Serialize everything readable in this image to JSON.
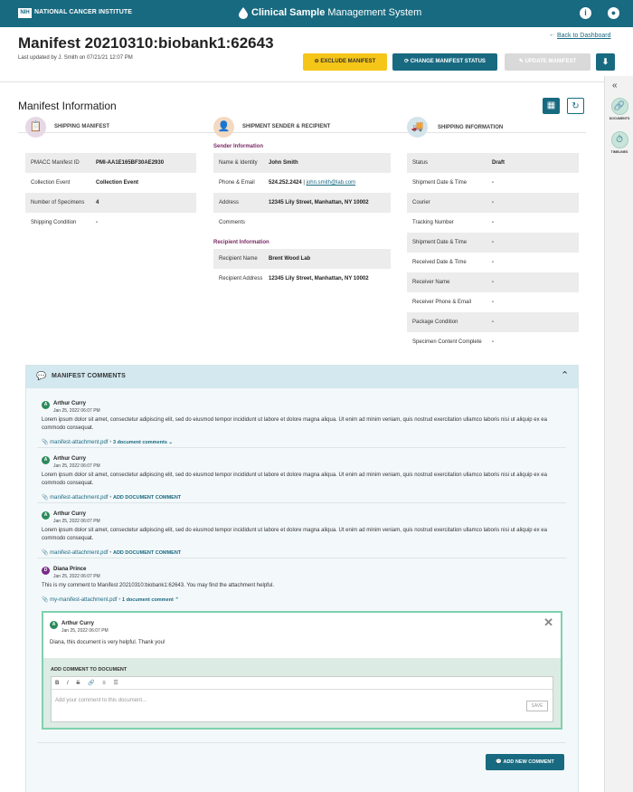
{
  "topbar": {
    "logo_badge": "NIH",
    "org": "NATIONAL CANCER INSTITUTE",
    "app_title_bold": "Clinical Sample",
    "app_title_rest": " Management System",
    "info_icon": "info-icon",
    "user_icon": "user-icon",
    "color": "#186a80"
  },
  "header": {
    "title": "Manifest 20210310:biobank1:62643",
    "updated": "Last updated by J. Smith on 07/21/21 12:07 PM",
    "back_link": "Back to Dashboard",
    "buttons": {
      "exclude": "EXCLUDE MANIFEST",
      "change": "CHANGE MANIFEST STATUS",
      "update": "UPDATE MANIFEST"
    }
  },
  "colors": {
    "primary": "#186a80",
    "exclude": "#f5c518",
    "accent": "#7a2a66",
    "highlight": "#7fd1ad"
  },
  "side_panel": {
    "items": [
      {
        "label": "DOCUMENTS",
        "icon": "paperclip-icon"
      },
      {
        "label": "TIMELINES",
        "icon": "stopwatch-icon"
      }
    ]
  },
  "manifest_info": {
    "title": "Manifest Information",
    "shipping_manifest": {
      "title": "SHIPPING MANIFEST",
      "rows": [
        {
          "k": "PMACC Manifest ID",
          "v": "PMI-AA1E165BF30AE2930"
        },
        {
          "k": "Collection Event",
          "v": "Collection Event"
        },
        {
          "k": "Number of Specimens",
          "v": "4"
        },
        {
          "k": "Shipping Condition",
          "v": "-"
        }
      ]
    },
    "sender_recipient": {
      "title": "SHIPMENT SENDER & RECIPIENT",
      "sender_title": "Sender Information",
      "sender_rows": [
        {
          "k": "Name & Identity",
          "v": "John Smith"
        },
        {
          "k": "Phone & Email",
          "phone": "524.252.2424",
          "sep": " | ",
          "email": "john.smith@lab.com"
        },
        {
          "k": "Address",
          "v": "12345 Lily Street, Manhattan, NY 10002"
        },
        {
          "k": "Comments",
          "v": ""
        }
      ],
      "recipient_title": "Recipient Information",
      "recipient_rows": [
        {
          "k": "Recipient Name",
          "v": "Brent Wood Lab"
        },
        {
          "k": "Recipient Address",
          "v": "12345 Lily Street, Manhattan, NY 10002"
        }
      ]
    },
    "shipping_info": {
      "title": "SHIPPING INFORMATION",
      "rows": [
        {
          "k": "Status",
          "v": "Draft"
        },
        {
          "k": "Shipment Date & Time",
          "v": "-"
        },
        {
          "k": "Courier",
          "v": "-"
        },
        {
          "k": "Tracking Number",
          "v": "-"
        },
        {
          "k": "Shipment Date & Time",
          "v": "-"
        },
        {
          "k": "Received Date & Time",
          "v": "-"
        },
        {
          "k": "Receiver Name",
          "v": "-"
        },
        {
          "k": "Receiver Phone & Email",
          "v": "-"
        },
        {
          "k": "Package Condition",
          "v": "-"
        },
        {
          "k": "Specimen Content Complete",
          "v": "-"
        }
      ]
    }
  },
  "comments": {
    "title": "MANIFEST COMMENTS",
    "items": [
      {
        "initial": "A",
        "name": "Arthur Curry",
        "date": "Jan 25, 2022 06:07 PM",
        "text": "Lorem ipsum dolor sit amet, consectetur adipiscing elit, sed do eiusmod tempor incididunt ut labore et dolore magna aliqua. Ut enim ad minim veniam, quis nostrud exercitation ullamco laboris nisi ut aliquip ex ea commodo consequat.",
        "file": "manifest-attachment.pdf",
        "action": "3 document comments ⌄"
      },
      {
        "initial": "A",
        "name": "Arthur Curry",
        "date": "Jan 25, 2022 06:07 PM",
        "text": "Lorem ipsum dolor sit amet, consectetur adipiscing elit, sed do eiusmod tempor incididunt ut labore et dolore magna aliqua. Ut enim ad minim veniam, quis nostrud exercitation ullamco laboris nisi ut aliquip ex ea commodo consequat.",
        "file": "manifest-attachment.pdf",
        "action": "ADD DOCUMENT COMMENT"
      },
      {
        "initial": "A",
        "name": "Arthur Curry",
        "date": "Jan 25, 2022 06:07 PM",
        "text": "Lorem ipsum dolor sit amet, consectetur adipiscing elit, sed do eiusmod tempor incididunt ut labore et dolore magna aliqua. Ut enim ad minim veniam, quis nostrud exercitation ullamco laboris nisi ut aliquip ex ea commodo consequat.",
        "file": "manifest-attachment.pdf",
        "action": "ADD DOCUMENT COMMENT"
      },
      {
        "initial": "D",
        "name": "Diana Prince",
        "date": "Jan 25, 2022 06:07 PM",
        "text": "This is my comment to Manifest 20210310:biobank1:62643. You may find the attachment helpful.",
        "file": "my-manifest-attachment.pdf",
        "action": "1 document comment ⌃"
      }
    ],
    "doc_comment": {
      "initial": "A",
      "name": "Arthur Curry",
      "date": "Jan 25, 2022 06:07 PM",
      "text": "Diana, this document is very helpful. Thank you!"
    },
    "add_doc_comment": {
      "title": "ADD COMMENT TO DOCUMENT",
      "placeholder": "Add your comment to this document...",
      "save": "SAVE",
      "toolbar": [
        "B",
        "I",
        "S",
        "🔗",
        "≡",
        "☰"
      ]
    },
    "add_new": "ADD NEW COMMENT"
  }
}
